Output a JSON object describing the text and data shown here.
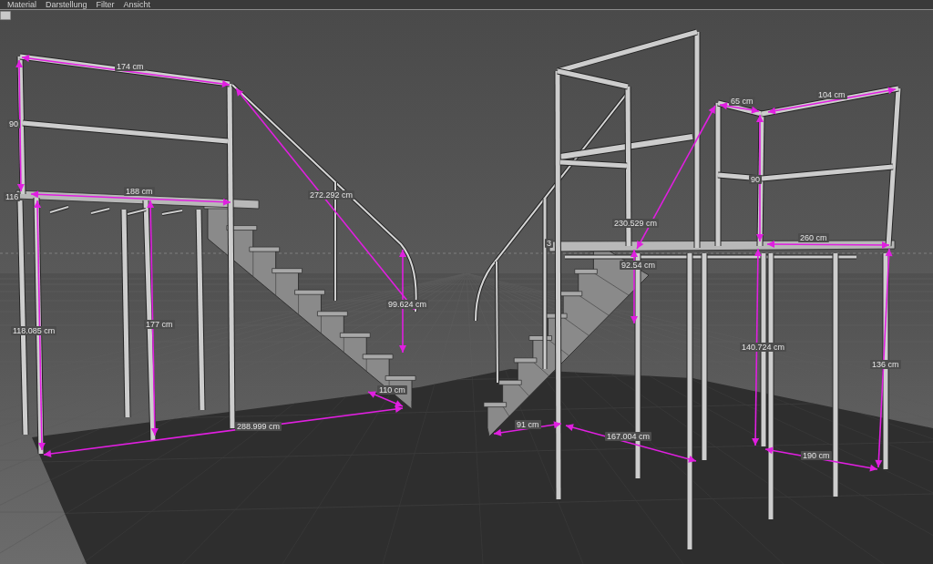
{
  "menu_bar": {
    "items": [
      "Material",
      "Darstellung",
      "Filter",
      "Ansicht"
    ]
  },
  "viewport": {
    "dimension_labels": [
      "174 cm",
      "90",
      "116",
      "188 cm",
      "272.292 cm",
      "99.624 cm",
      "118.085 cm",
      "177 cm",
      "288.999 cm",
      "110 cm",
      "65 cm",
      "104 cm",
      "230.529 cm",
      "92.54 cm",
      "260 cm",
      "90",
      "3",
      "140.724 cm",
      "136 cm",
      "91 cm",
      "167.004 cm",
      "190 cm"
    ]
  }
}
